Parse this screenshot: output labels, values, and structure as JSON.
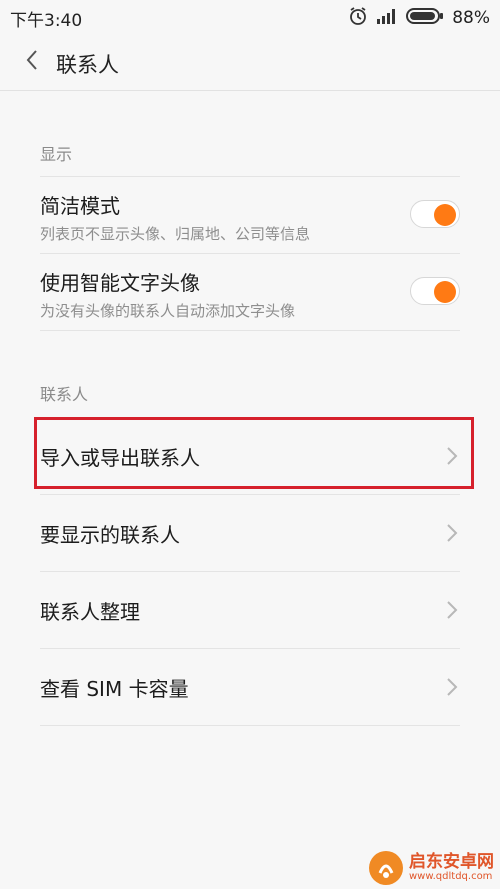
{
  "status_bar": {
    "time": "下午3:40",
    "battery_percent": "88%",
    "icons": [
      "alarm-icon",
      "signal-icon",
      "battery-icon"
    ]
  },
  "header": {
    "title": "联系人",
    "back_icon": "chevron-left-icon"
  },
  "sections": {
    "display": {
      "label": "显示",
      "items": [
        {
          "title": "简洁模式",
          "subtitle": "列表页不显示头像、归属地、公司等信息",
          "enabled": true
        },
        {
          "title": "使用智能文字头像",
          "subtitle": "为没有头像的联系人自动添加文字头像",
          "enabled": true
        }
      ]
    },
    "contacts": {
      "label": "联系人",
      "items": [
        {
          "label": "导入或导出联系人",
          "highlighted": true
        },
        {
          "label": "要显示的联系人"
        },
        {
          "label": "联系人整理"
        },
        {
          "label": "查看 SIM 卡容量"
        }
      ]
    }
  },
  "colors": {
    "accent": "#ff7a14",
    "highlight_border": "#d6202c",
    "background": "#f7f7f7"
  },
  "watermark": {
    "main": "启东安卓网",
    "sub": "www.qdltdq.com"
  }
}
